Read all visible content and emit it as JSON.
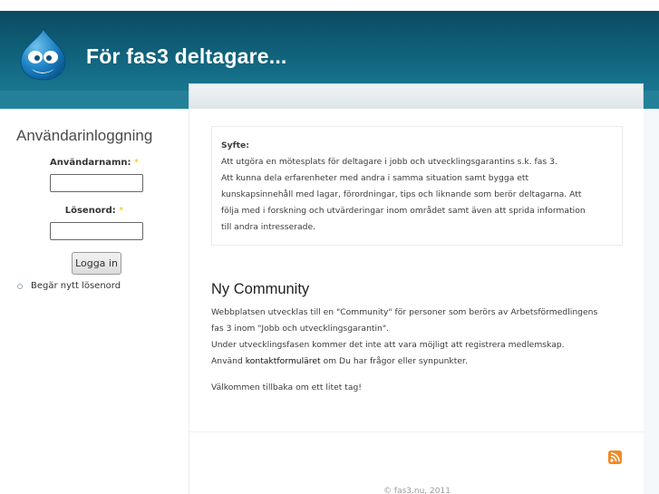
{
  "header": {
    "site_name": "För fas3 deltagare..."
  },
  "login": {
    "title": "Användarinloggning",
    "username_label": "Användarnamn:",
    "password_label": "Lösenord:",
    "required_mark": "*",
    "username_value": "",
    "password_value": "",
    "submit_label": "Logga in",
    "new_password_link": "Begär nytt lösenord"
  },
  "mission": {
    "title": "Syfte:",
    "lines": [
      "Att utgöra en mötesplats för deltagare i jobb och utvecklingsgarantins s.k. fas 3.",
      "Att kunna dela erfarenheter med andra i samma situation samt bygga ett",
      "kunskapsinnehåll med lagar, förordningar, tips och liknande som berör deltagarna. Att",
      "följa med i forskning och utvärderingar inom området samt även att sprida information",
      "till andra intresserade."
    ]
  },
  "article": {
    "title": "Ny Community",
    "line1": "Webbplatsen utvecklas till en \"Community\" för personer som berörs av Arbetsförmedlingens",
    "line2": "fas 3 inom \"Jobb och utvecklingsgarantin\".",
    "line3": "Under utvecklingsfasen kommer det inte att vara möjligt att registrera medlemskap.",
    "line4_pre": "Använd ",
    "line4_link": "kontaktformuläret",
    "line4_post": " om Du har frågor eller synpunkter.",
    "welcome": "Välkommen tillbaka om ett litet tag!"
  },
  "footer": {
    "copyright": "© fas3.nu, 2011"
  },
  "icons": {
    "logo": "drupal-drop-icon",
    "feed": "rss-feed-icon"
  },
  "colors": {
    "header": "#0f5d76",
    "required": "#f8bc00",
    "rss": "#f08a24"
  }
}
